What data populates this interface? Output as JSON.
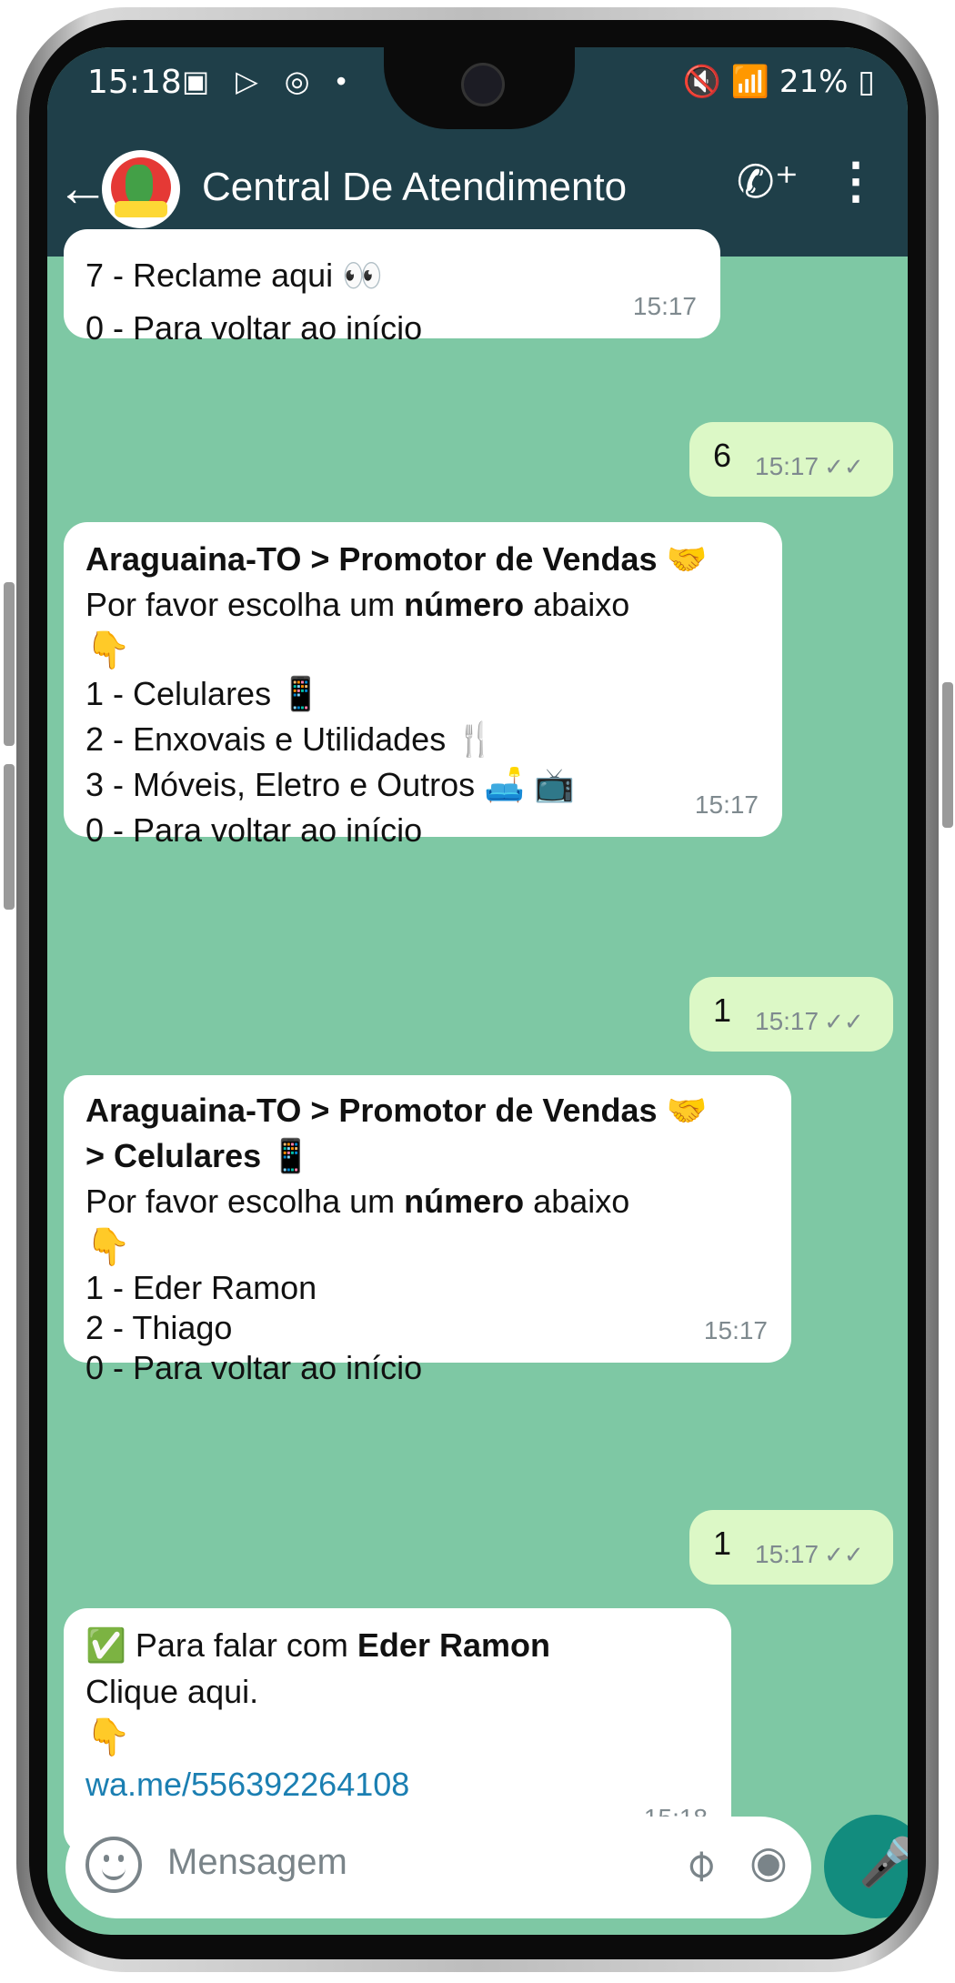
{
  "status": {
    "time": "15:18",
    "left_icons": "▣ ▷ ◎ •",
    "battery": "21%",
    "right_icons": "🔇 📶"
  },
  "header": {
    "title": "Central De Atendimento",
    "back_icon": "arrow-left",
    "call_icon": "add-call",
    "menu_icon": "more-vertical"
  },
  "messages": [
    {
      "id": "m1",
      "direction": "in",
      "lines": [
        "7 - Reclame aqui 👀",
        "0 - Para voltar ao início"
      ],
      "time": "15:17"
    },
    {
      "id": "m2",
      "direction": "out",
      "text": "6",
      "time": "15:17",
      "ticks": "✓✓"
    },
    {
      "id": "m3",
      "direction": "in",
      "title": "Araguaina-TO > Promotor de Vendas 🤝",
      "prompt_pre": "Por favor escolha um ",
      "prompt_bold": "número",
      "prompt_post": " abaixo",
      "pointer": "👇",
      "options": [
        "1 - Celulares 📱",
        "2 - Enxovais e Utilidades 🍴",
        "3 - Móveis, Eletro e Outros 🛋️ 📺",
        "0 - Para voltar ao início"
      ],
      "time": "15:17"
    },
    {
      "id": "m4",
      "direction": "out",
      "text": "1",
      "time": "15:17",
      "ticks": "✓✓"
    },
    {
      "id": "m5",
      "direction": "in",
      "title1": "Araguaina-TO > Promotor de Vendas 🤝",
      "title2": "> Celulares 📱",
      "prompt_pre": "Por favor escolha um ",
      "prompt_bold": "número",
      "prompt_post": " abaixo",
      "pointer": "👇",
      "options": [
        "1 - Eder Ramon",
        "2 - Thiago",
        "0 - Para voltar ao início"
      ],
      "time": "15:17"
    },
    {
      "id": "m6",
      "direction": "out",
      "text": "1",
      "time": "15:17",
      "ticks": "✓✓"
    },
    {
      "id": "m7",
      "direction": "in",
      "check": "✅",
      "line1_pre": " Para falar com ",
      "line1_bold": "Eder Ramon",
      "line2": "Clique aqui.",
      "pointer": "👇",
      "link": "wa.me/556392264108",
      "time": "15:18"
    }
  ],
  "composer": {
    "placeholder": "Mensagem",
    "emoji_icon": "emoji",
    "attach_icon": "paperclip",
    "camera_icon": "camera",
    "mic_icon": "microphone"
  },
  "colors": {
    "header": "#1f3f49",
    "chat_bg": "#7ec8a4",
    "incoming": "#ffffff",
    "outgoing": "#dcf8c6",
    "mic": "#128c7e",
    "link": "#1b7fb2"
  }
}
